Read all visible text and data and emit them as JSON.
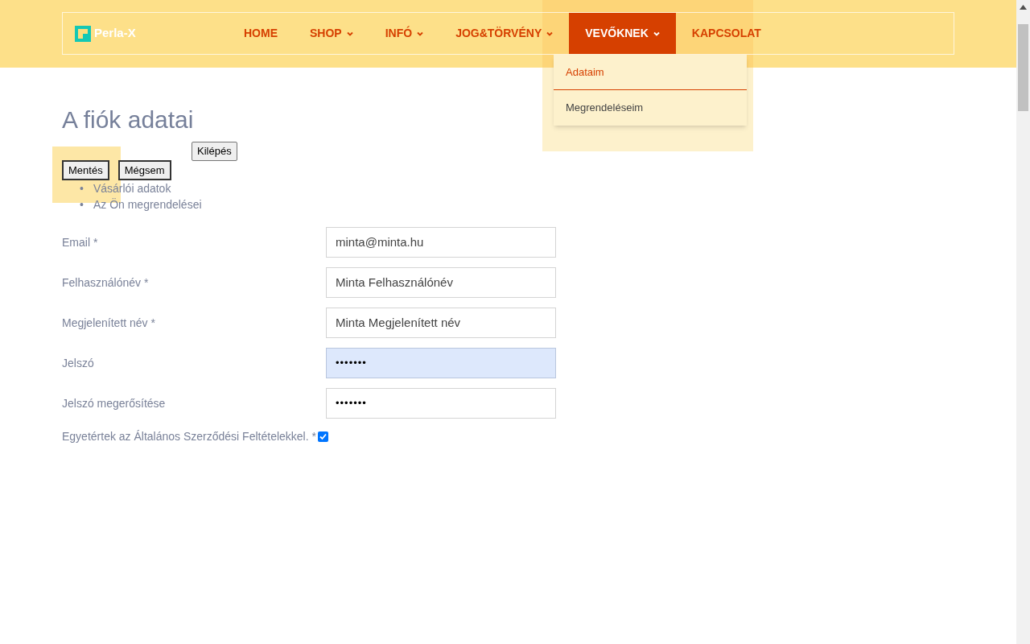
{
  "logo": {
    "text": "Perla-X"
  },
  "nav": [
    {
      "label": "HOME",
      "dropdown": false,
      "selected": false
    },
    {
      "label": "SHOP",
      "dropdown": true,
      "selected": false
    },
    {
      "label": "INFÓ",
      "dropdown": true,
      "selected": false
    },
    {
      "label": "JOG&TÖRVÉNY",
      "dropdown": true,
      "selected": false
    },
    {
      "label": "VEVŐKNEK",
      "dropdown": true,
      "selected": true
    },
    {
      "label": "KAPCSOLAT",
      "dropdown": false,
      "selected": false
    }
  ],
  "dropdown_menu": [
    {
      "label": "Adataim",
      "selected": true
    },
    {
      "label": "Megrendeléseim",
      "selected": false
    }
  ],
  "page_title": "A fiók adatai",
  "buttons": {
    "logout": "Kilépés",
    "save": "Mentés",
    "cancel": "Mégsem"
  },
  "links": [
    {
      "marker": "•",
      "label": "Vásárlói adatok"
    },
    {
      "marker": "•",
      "label": "Az Ön megrendelései"
    }
  ],
  "fields": [
    {
      "label": "Email *",
      "value": "minta@minta.hu",
      "kind": "text",
      "autofilled": false
    },
    {
      "label": "Felhasználónév *",
      "value": "Minta Felhasználónév",
      "kind": "text",
      "autofilled": false
    },
    {
      "label": "Megjelenített név *",
      "value": "Minta Megjelenített név",
      "kind": "text",
      "autofilled": false
    },
    {
      "label": "Jelszó",
      "value": "•••••••",
      "kind": "password",
      "autofilled": true
    },
    {
      "label": "Jelszó megerősítése",
      "value": "•••••••",
      "kind": "password",
      "autofilled": false
    }
  ],
  "terms": {
    "label": "Egyetértek az Általános Szerződési Feltételekkel. *",
    "checked": true
  }
}
